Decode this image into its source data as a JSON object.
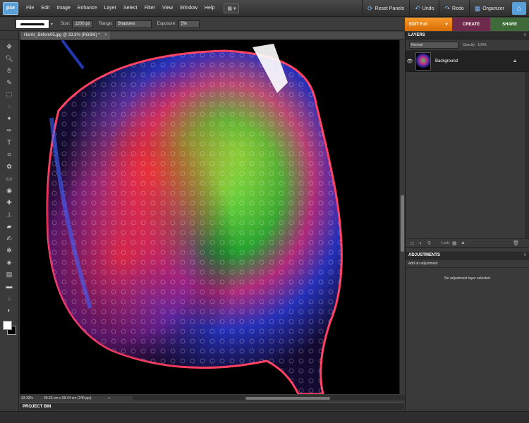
{
  "app": {
    "logo_text": "pse"
  },
  "menu": [
    "File",
    "Edit",
    "Image",
    "Enhance",
    "Layer",
    "Select",
    "Filter",
    "View",
    "Window",
    "Help"
  ],
  "right_menu": {
    "reset_panels": "Reset Panels",
    "undo": "Undo",
    "redo": "Redo",
    "organizer": "Organizer"
  },
  "options": {
    "size_label": "Size:",
    "size_value": "1200 px",
    "range_label": "Range:",
    "range_value": "Shadows",
    "exposure_label": "Exposure:",
    "exposure_value": "5%"
  },
  "modes": {
    "edit": "EDIT Full",
    "create": "CREATE",
    "share": "SHARE"
  },
  "document": {
    "tab_title": "Harris_Before05.jpg @ 33.3% (RGB/8) *",
    "close": "×",
    "zoom": "33.33%",
    "info": "39.62 cm x 59.44 cm (240 ppi)"
  },
  "project_bin": "PROJECT BIN",
  "layers_panel": {
    "title": "LAYERS",
    "blend_mode": "Normal",
    "opacity_label": "Opacity:",
    "opacity_value": "100%",
    "layer_name": "Background",
    "lock_label": "Lock:"
  },
  "adjustments_panel": {
    "title": "ADJUSTMENTS",
    "add_label": "Add an adjustment",
    "empty_message": "No adjustment layer selected"
  },
  "colors": {
    "accent": "#5aa0d8",
    "edit_tab": "#e9820f",
    "create_tab": "#6e2a4a",
    "share_tab": "#3f6b3a"
  }
}
